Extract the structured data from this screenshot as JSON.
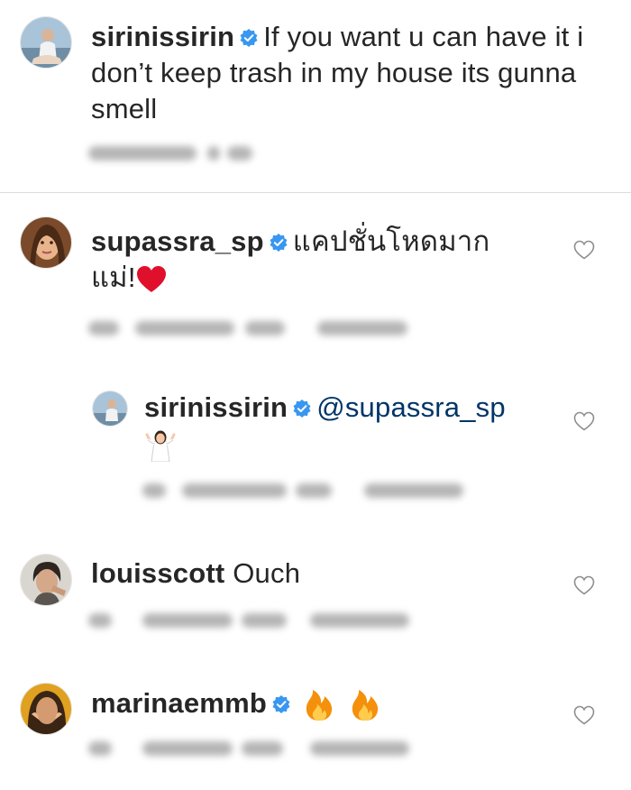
{
  "caption": {
    "username": "sirinissirin",
    "text": "If you want u can have it i don’t keep trash in my house its gunna smell"
  },
  "comments": [
    {
      "username": "supassra_sp",
      "text": "แคปชั่นโหดมาก แม่!",
      "emoji": "heart",
      "reply": {
        "username": "sirinissirin",
        "mention": "@supassra_sp",
        "emoji": "person-shrugging"
      }
    },
    {
      "username": "louisscott",
      "text": "Ouch"
    },
    {
      "username": "marinaemmb",
      "emoji": "fire fire"
    }
  ],
  "colors": {
    "verified": "#3897f0",
    "mention": "#003569",
    "divider": "#dbdbdb",
    "heart_red": "#e0102d",
    "fire": "#f4900c"
  }
}
